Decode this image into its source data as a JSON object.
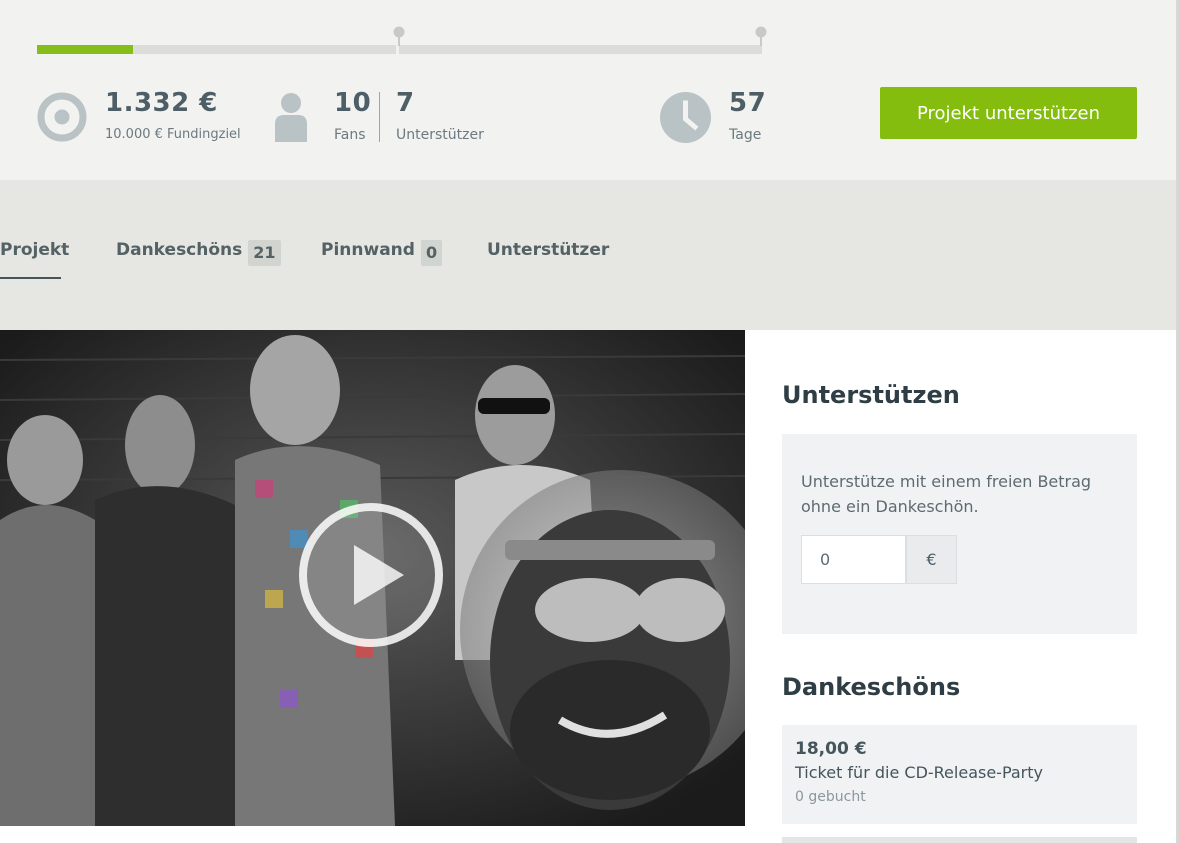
{
  "funding": {
    "progress_fraction": 0.133,
    "amount": "1.332 €",
    "goal_label": "10.000 € Fundingziel"
  },
  "fans": {
    "count": "10",
    "label": "Fans"
  },
  "supporters": {
    "count": "7",
    "label": "Unterstützer"
  },
  "days": {
    "count": "57",
    "label": "Tage"
  },
  "cta": {
    "label": "Projekt unterstützen"
  },
  "tabs": [
    {
      "label": "Projekt",
      "count": ""
    },
    {
      "label": "Dankeschöns",
      "count": "21"
    },
    {
      "label": "Pinnwand",
      "count": "0"
    },
    {
      "label": "Unterstützer",
      "count": ""
    }
  ],
  "sidebar": {
    "support_title": "Unterstützen",
    "free_amount_text": "Unterstütze mit einem freien Betrag ohne ein Dankeschön.",
    "amount_value": "0",
    "currency": "€",
    "rewards_title": "Dankeschöns",
    "rewards": [
      {
        "price": "18,00 €",
        "title": "Ticket für die CD-Release-Party",
        "booked": "0 gebucht"
      }
    ]
  },
  "colors": {
    "accent_green": "#85bd0f",
    "text_dark": "#44555c",
    "panel_bg": "#f2f2f0",
    "tabs_bg": "#e6e7e2"
  },
  "icons": {
    "funding": "target-icon",
    "fans": "person-icon",
    "days": "clock-icon",
    "video": "play-icon"
  }
}
